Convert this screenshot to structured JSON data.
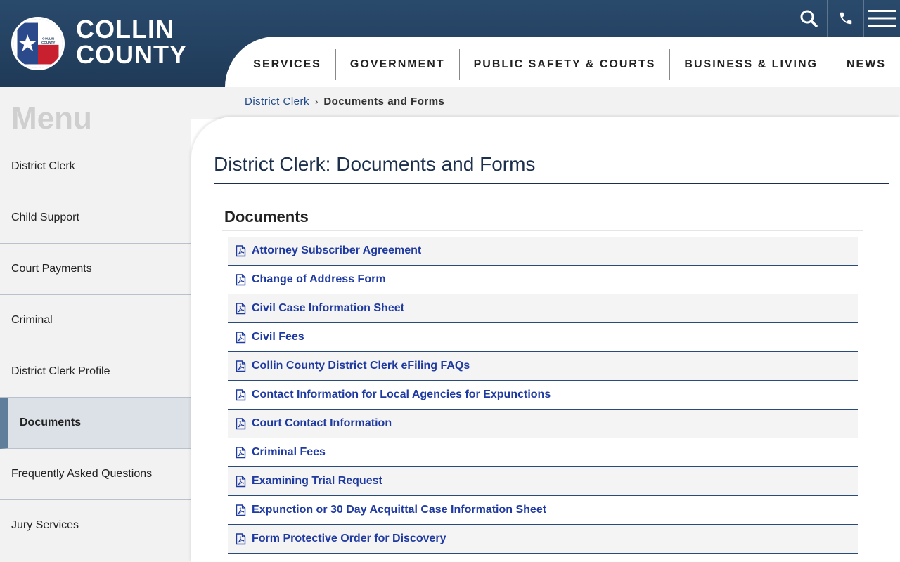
{
  "header": {
    "brand_line1": "COLLIN",
    "brand_line2": "COUNTY",
    "logo_text": "COLLIN COUNTY",
    "icons": [
      "search-icon",
      "phone-icon",
      "hamburger-menu-icon"
    ],
    "colors": {
      "header_bg": "#1f3a58",
      "link": "#1f3aa0",
      "title": "#1c2f4d"
    }
  },
  "nav": [
    "SERVICES",
    "GOVERNMENT",
    "PUBLIC SAFETY & COURTS",
    "BUSINESS & LIVING",
    "NEWS"
  ],
  "breadcrumb": {
    "parent": "District Clerk",
    "separator": "›",
    "current": "Documents and Forms"
  },
  "sidebar": {
    "title": "Menu",
    "items": [
      "District Clerk",
      "Child Support",
      "Court Payments",
      "Criminal",
      "District Clerk Profile",
      "Documents",
      "Frequently Asked Questions",
      "Jury Services"
    ],
    "active": "Documents"
  },
  "main": {
    "title": "District Clerk: Documents and Forms",
    "section": "Documents",
    "documents": [
      "Attorney Subscriber Agreement",
      "Change of Address Form",
      "Civil Case Information Sheet",
      "Civil Fees",
      "Collin County District Clerk eFiling FAQs",
      "Contact Information for Local Agencies for Expunctions",
      "Court Contact Information",
      "Criminal Fees",
      "Examining Trial Request",
      "Expunction or 30 Day Acquittal Case Information Sheet",
      "Form Protective Order for Discovery"
    ]
  }
}
